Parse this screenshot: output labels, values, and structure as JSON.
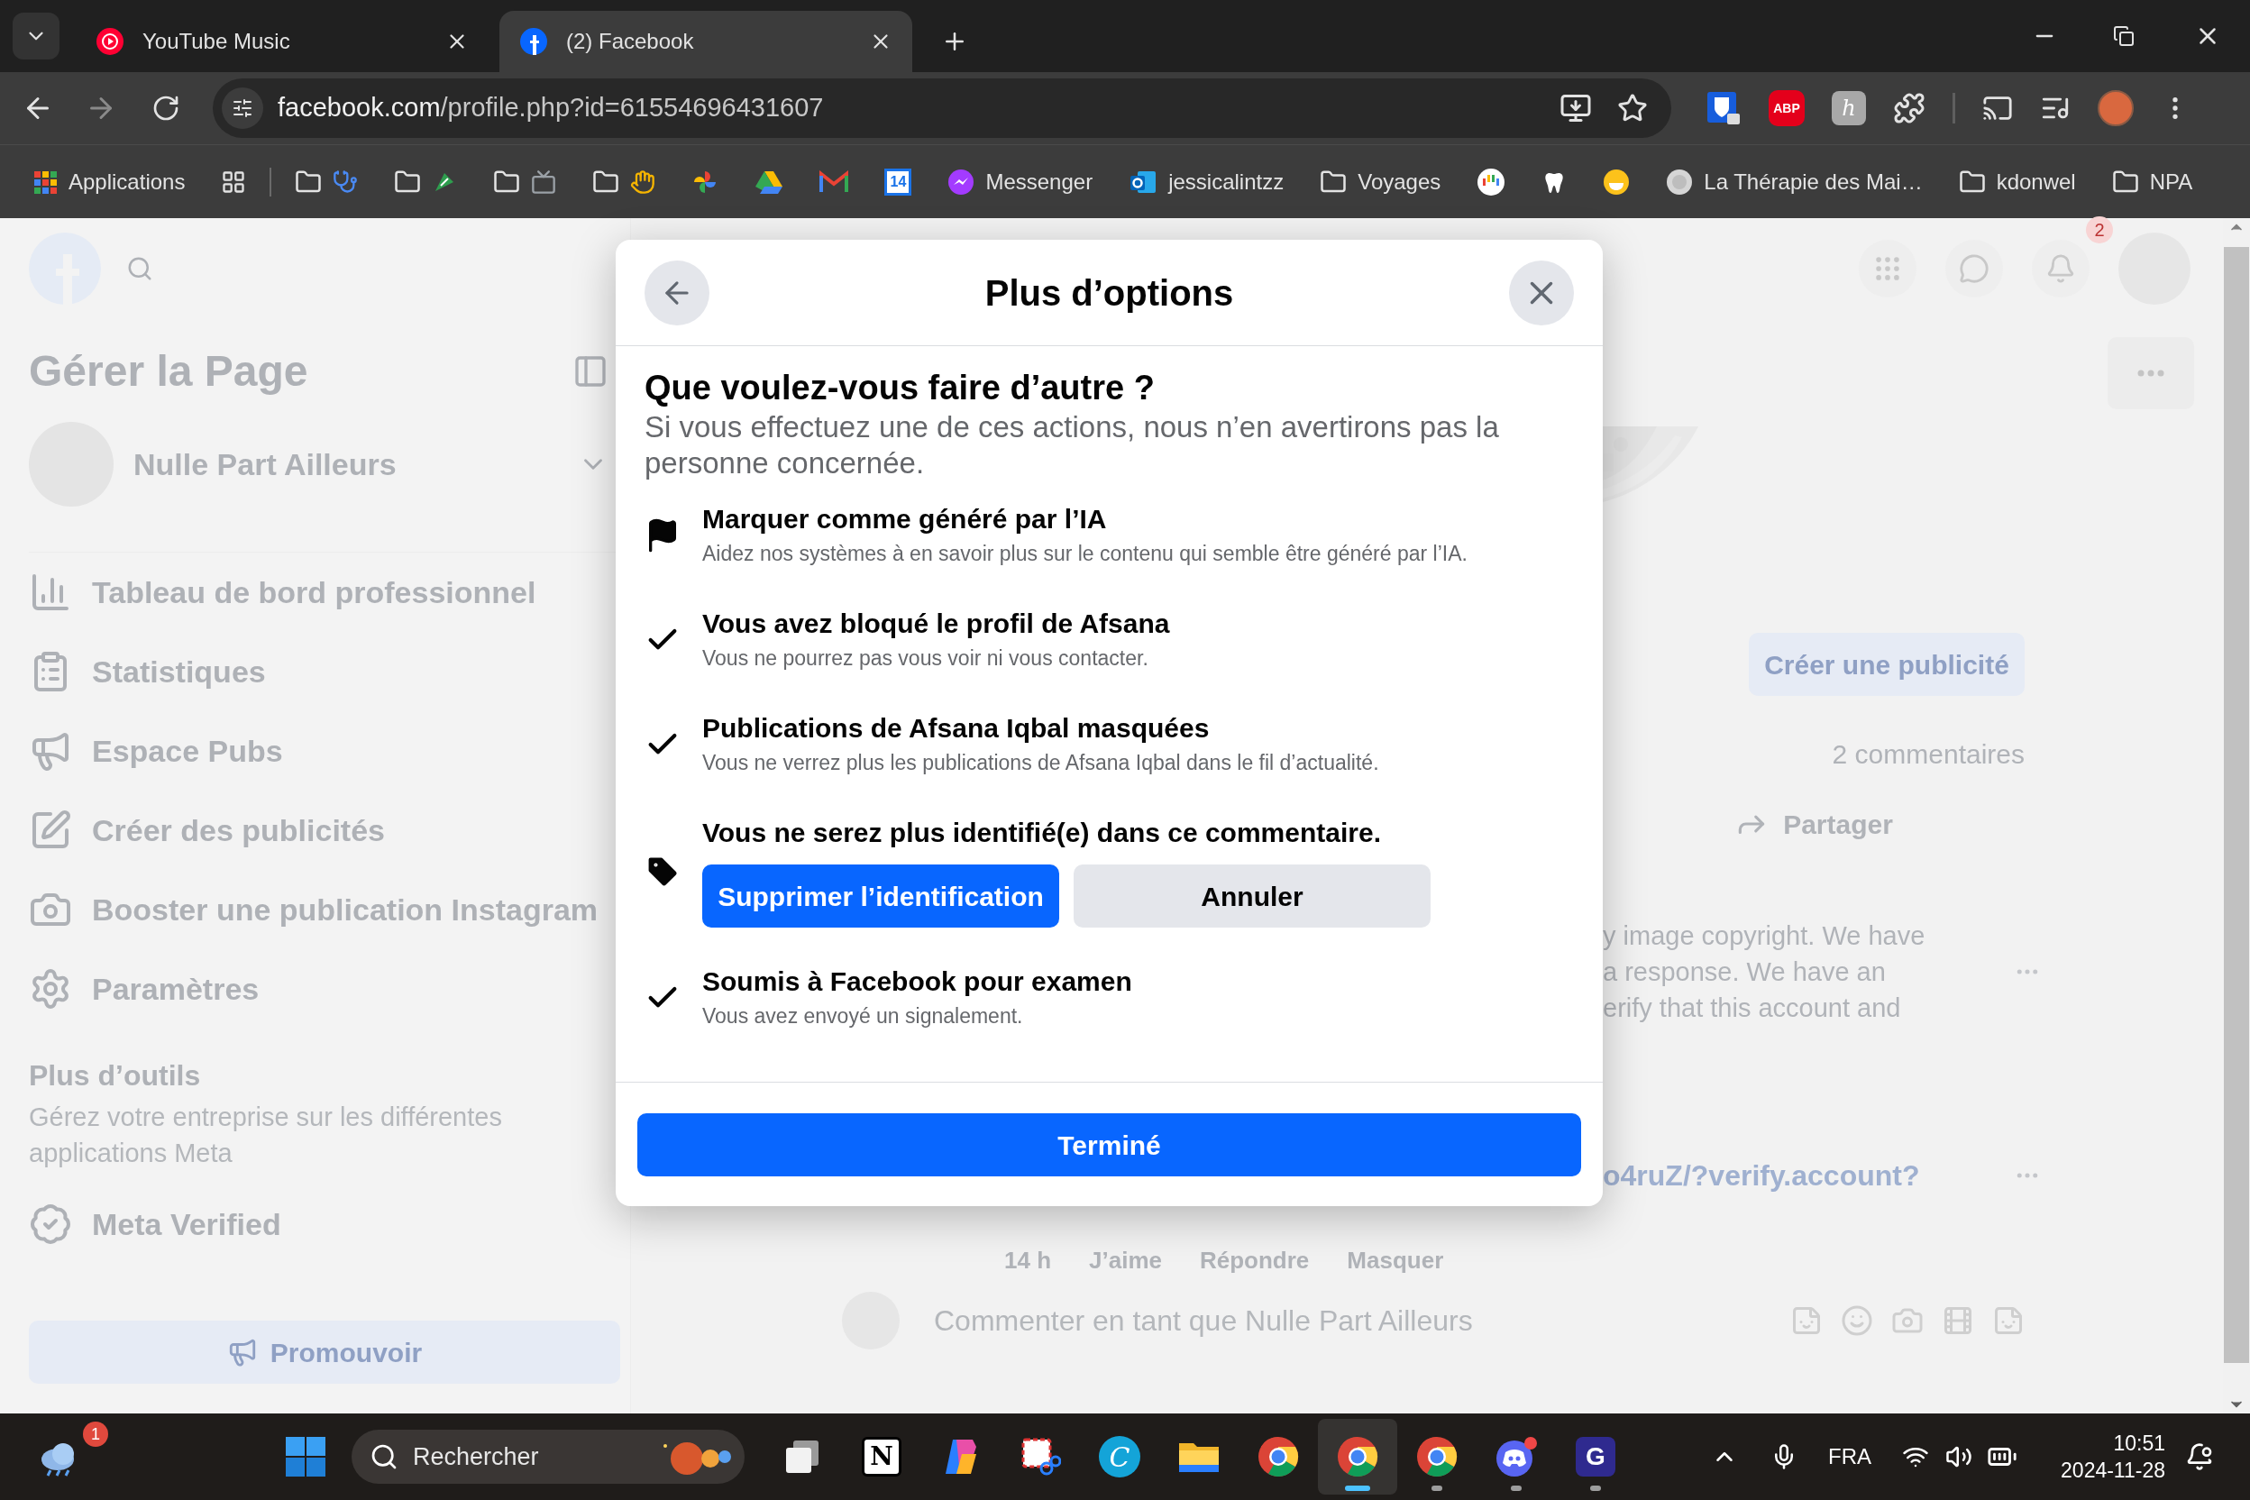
{
  "browser": {
    "tabs": [
      {
        "kind": "play",
        "title": "YouTube Music",
        "selected": false
      },
      {
        "kind": "social",
        "title": "(2) Facebook",
        "selected": true
      }
    ],
    "url": {
      "host": "facebook.com",
      "path": "/profile.php?id=61554696431607"
    },
    "extensions": [
      {
        "kind": "shield"
      },
      {
        "kind": "stop",
        "label": "ABP"
      },
      {
        "kind": "tile",
        "label": "h"
      },
      {
        "kind": "puzzle"
      }
    ],
    "bookmarks": [
      {
        "kind": "link",
        "label": "Applications"
      },
      {
        "kind": "link"
      },
      {
        "kind": "folder"
      },
      {
        "kind": "folder"
      },
      {
        "kind": "folder"
      },
      {
        "kind": "folder"
      },
      {
        "kind": "link"
      },
      {
        "kind": "link"
      },
      {
        "kind": "link"
      },
      {
        "kind": "link",
        "icon_text": "14"
      },
      {
        "kind": "link",
        "label": "Messenger"
      },
      {
        "kind": "link",
        "label": "jessicalintzz"
      },
      {
        "kind": "folder",
        "label": "Voyages"
      },
      {
        "kind": "link"
      },
      {
        "kind": "link"
      },
      {
        "kind": "link"
      },
      {
        "kind": "link",
        "label": "La Thérapie des Mai…"
      },
      {
        "kind": "folder",
        "label": "kdonwel"
      },
      {
        "kind": "folder",
        "label": "NPA"
      }
    ]
  },
  "page": {
    "sidebar": {
      "title": "Gérer la Page",
      "page_name": "Nulle Part Ailleurs",
      "items": [
        "Tableau de bord professionnel",
        "Statistiques",
        "Espace Pubs",
        "Créer des publicités",
        "Booster une publication Instagram",
        "Paramètres"
      ],
      "more_tools": {
        "title": "Plus d’outils",
        "description": "Gérez votre entreprise sur les différentes applications Meta"
      },
      "verified": "Meta Verified",
      "promote": "Promouvoir"
    },
    "header": {
      "notification_count": "2"
    },
    "feed": {
      "create_ad": "Créer une publicité",
      "comments_count": "2 commentaires",
      "share": "Partager",
      "comment_lines": [
        "y image copyright. We have",
        "a response. We have an",
        "erify that this account and"
      ],
      "link_text": "o4ruZ/?verify.account?",
      "comment_actions": [
        "14 h",
        "J’aime",
        "Répondre",
        "Masquer"
      ],
      "comment_placeholder": "Commenter en tant que Nulle Part Ailleurs"
    }
  },
  "modal": {
    "title": "Plus d’options",
    "heading": "Que voulez-vous faire d’autre ?",
    "subheading": "Si vous effectuez une de ces actions, nous n’en avertirons pas la personne concernée.",
    "items": [
      {
        "kind": "flag",
        "title": "Marquer comme généré par l’IA",
        "description": "Aidez nos systèmes à en savoir plus sur le contenu qui semble être généré par l’IA."
      },
      {
        "kind": "check",
        "title": "Vous avez bloqué le profil de Afsana",
        "description": "Vous ne pourrez pas vous voir ni vous contacter."
      },
      {
        "kind": "check",
        "title": "Publications de Afsana Iqbal masquées",
        "description": "Vous ne verrez plus les publications de Afsana Iqbal dans le fil d’actualité."
      },
      {
        "kind": "tag",
        "title": "Vous ne serez plus identifié(e) dans ce commentaire.",
        "actions": [
          {
            "label": "Supprimer l’identification"
          },
          {
            "label": "Annuler"
          }
        ]
      },
      {
        "kind": "check",
        "title": "Soumis à Facebook pour examen",
        "description": "Vous avez envoyé un signalement."
      }
    ],
    "done": "Terminé"
  },
  "taskbar": {
    "weather_badge": "1",
    "search_label": "Rechercher",
    "apps": [
      {
        "kind": "taskview",
        "running": false,
        "selected": false
      },
      {
        "kind": "notion",
        "label": "N",
        "running": false,
        "selected": false
      },
      {
        "kind": "copilot",
        "running": false,
        "selected": false
      },
      {
        "kind": "snip",
        "running": false,
        "selected": false
      },
      {
        "kind": "canva",
        "label": "C",
        "running": false,
        "selected": false
      },
      {
        "kind": "files",
        "running": false,
        "selected": false
      },
      {
        "kind": "chrome",
        "running": false,
        "selected": false
      },
      {
        "kind": "chrome",
        "running": true,
        "selected": true
      },
      {
        "kind": "chrome",
        "running": true,
        "selected": false
      },
      {
        "kind": "discord",
        "running": true,
        "selected": false
      },
      {
        "kind": "app",
        "label": "G",
        "running": true,
        "selected": false
      }
    ],
    "language": "FRA",
    "time": "10:51",
    "date": "2024-11-28"
  }
}
